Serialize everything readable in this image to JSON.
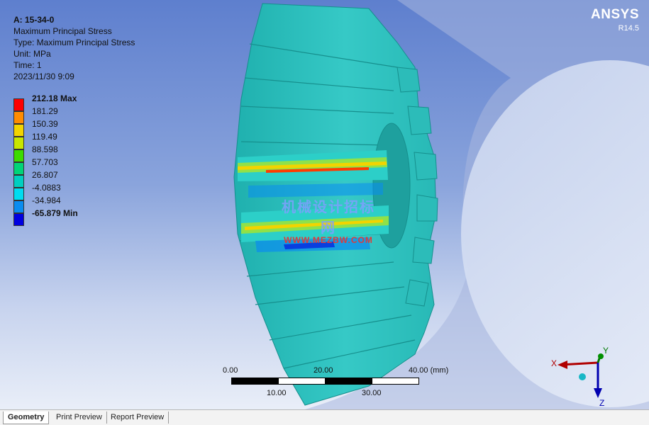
{
  "result": {
    "name": "A: 15-34-0",
    "line1": "Maximum Principal Stress",
    "line2": "Type: Maximum Principal Stress",
    "line3": "Unit: MPa",
    "line4": "Time: 1",
    "line5": "2023/11/30 9:09"
  },
  "legend": {
    "entries": [
      {
        "label": "212.18 Max",
        "color": "#ff0000",
        "bold": true
      },
      {
        "label": "181.29",
        "color": "#ff8c00",
        "bold": false
      },
      {
        "label": "150.39",
        "color": "#f2d400",
        "bold": false
      },
      {
        "label": "119.49",
        "color": "#c8e600",
        "bold": false
      },
      {
        "label": "88.598",
        "color": "#3cdc00",
        "bold": false
      },
      {
        "label": "57.703",
        "color": "#00d478",
        "bold": false
      },
      {
        "label": "26.807",
        "color": "#00cfc0",
        "bold": false
      },
      {
        "label": "-4.0883",
        "color": "#00dcf0",
        "bold": false
      },
      {
        "label": "-34.984",
        "color": "#0a8cf0",
        "bold": false
      },
      {
        "label": "-65.879 Min",
        "color": "#0000e0",
        "bold": true
      }
    ]
  },
  "brand": {
    "name": "ANSYS",
    "version": "R14.5"
  },
  "scale": {
    "top_labels": [
      "0.00",
      "20.00",
      "40.00 (mm)"
    ],
    "bottom_labels": [
      "10.00",
      "30.00"
    ]
  },
  "watermark": {
    "cn": "机械设计招标网",
    "en": "WWW.MEZBW.COM"
  },
  "triad": {
    "x": "X",
    "y": "Y",
    "z": "Z"
  },
  "tabs": [
    {
      "label": "Geometry",
      "active": true
    },
    {
      "label": "Print Preview",
      "active": false
    },
    {
      "label": "Report Preview",
      "active": false
    }
  ],
  "colors": {
    "model": "#2fc3c0",
    "stress_high": "#ff0000",
    "stress_low": "#0000e0"
  }
}
